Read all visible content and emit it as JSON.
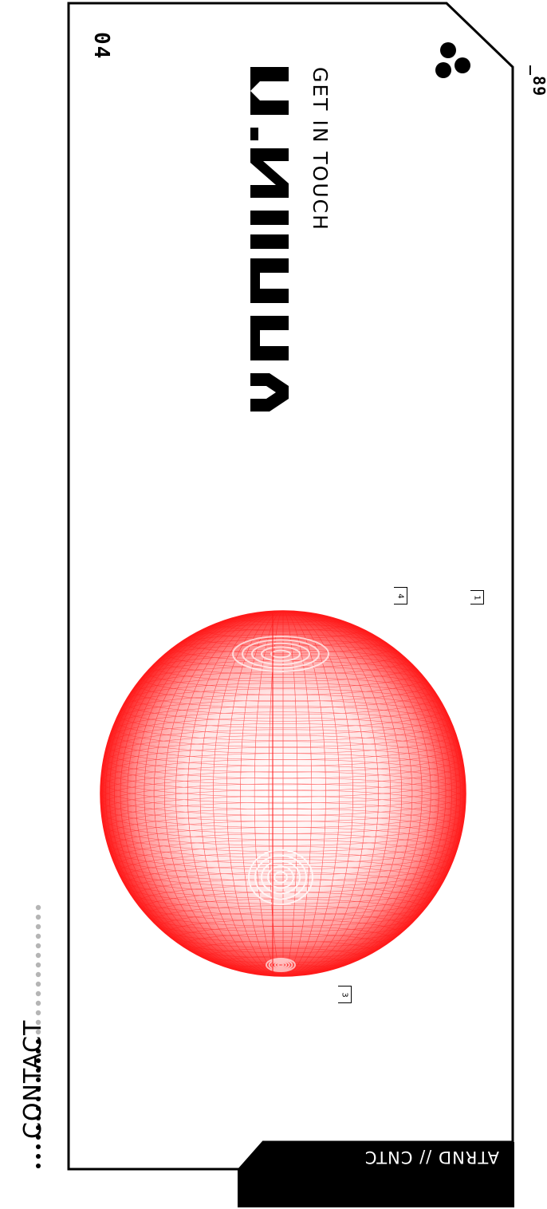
{
  "header": {
    "section_number": "04",
    "subtitle": "GET IN TOUCH",
    "corner_code": "_89",
    "logo_text": "CNTC"
  },
  "footer": {
    "label": "ATRND // CNTC"
  },
  "side_nav": {
    "label": "CONTACT",
    "dots_active": 14,
    "dots_total": 28
  },
  "markers": [
    "4",
    "1",
    "3"
  ],
  "colors": {
    "background": "#ffffff",
    "ink": "#000000",
    "sphere_accent": "#ff1a1a",
    "dot_inactive": "#b5b5b5"
  },
  "icons": {
    "brand": "three-dots-icon",
    "sphere": "wireframe-sphere"
  }
}
